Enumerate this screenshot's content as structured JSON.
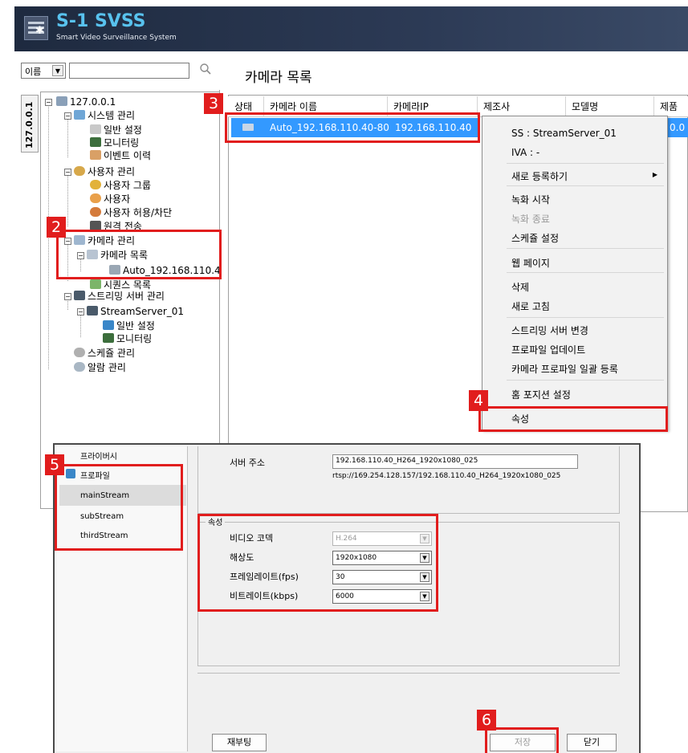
{
  "app": {
    "logo_title": "S-1 SVSS",
    "logo_subtitle": "Smart Video Surveillance System"
  },
  "search": {
    "field_label": "이름",
    "value": ""
  },
  "left_tab": "127.0.0.1",
  "tree": {
    "root": "127.0.0.1",
    "system_mgmt": "시스템 관리",
    "general_settings": "일반 설정",
    "monitoring": "모니터링",
    "event_history": "이벤트 이력",
    "user_mgmt": "사용자 관리",
    "user_group": "사용자 그룹",
    "user": "사용자",
    "user_allow_block": "사용자 허용/차단",
    "remote_send": "원격 전송",
    "camera_mgmt": "카메라 관리",
    "camera_list": "카메라 목록",
    "camera_auto": "Auto_192.168.110.4",
    "sequence_list": "시퀀스 목록",
    "streaming_mgmt": "스트리밍 서버 관리",
    "stream_server": "StreamServer_01",
    "ss_general_settings": "일반 설정",
    "ss_monitoring": "모니터링",
    "schedule_mgmt": "스케쥴 관리",
    "alarm_mgmt": "알람 관리"
  },
  "camera_list": {
    "title": "카메라 목록",
    "columns": [
      "상태",
      "카메라 이름",
      "카메라IP",
      "제조사",
      "모델명",
      "제품"
    ],
    "rows": [
      {
        "name": "Auto_192.168.110.40-80",
        "ip": "192.168.110.40",
        "extra": "0.0"
      }
    ]
  },
  "context_menu": {
    "info_ss": "SS : StreamServer_01",
    "info_iva": "IVA : -",
    "new_register": "새로 등록하기",
    "record_start": "녹화 시작",
    "record_stop": "녹화 종료",
    "schedule_settings": "스케쥴 설정",
    "web_page": "웹 페이지",
    "delete": "삭제",
    "refresh": "새로 고침",
    "change_streaming_server": "스트리밍 서버 변경",
    "update_profile": "프로파일 업데이트",
    "bulk_register_profile": "카메라 프로파일 일괄 등록",
    "home_position": "홈 포지션 설정",
    "properties": "속성"
  },
  "dialog": {
    "side_privacy": "프라이버시",
    "side_profile": "프로파일",
    "side_main": "mainStream",
    "side_sub": "subStream",
    "side_third": "thirdStream",
    "server_address_label": "서버 주소",
    "server_address_value": "192.168.110.40_H264_1920x1080_025",
    "rtsp_url": "rtsp://169.254.128.157/192.168.110.40_H264_1920x1080_025",
    "props_legend": "속성",
    "video_codec_label": "비디오 코덱",
    "video_codec_value": "H.264",
    "resolution_label": "해상도",
    "resolution_value": "1920x1080",
    "framerate_label": "프레임레이트(fps)",
    "framerate_value": "30",
    "bitrate_label": "비트레이트(kbps)",
    "bitrate_value": "6000",
    "reboot_button": "재부팅",
    "save_button": "저장",
    "close_button": "닫기"
  },
  "annotations": [
    "2",
    "3",
    "4",
    "5",
    "6"
  ],
  "colors": {
    "header_bg": "#1e2a3f",
    "logo_accent": "#58c2ee",
    "selection_blue": "#3399ff",
    "annotation_red": "#e11d1d"
  }
}
